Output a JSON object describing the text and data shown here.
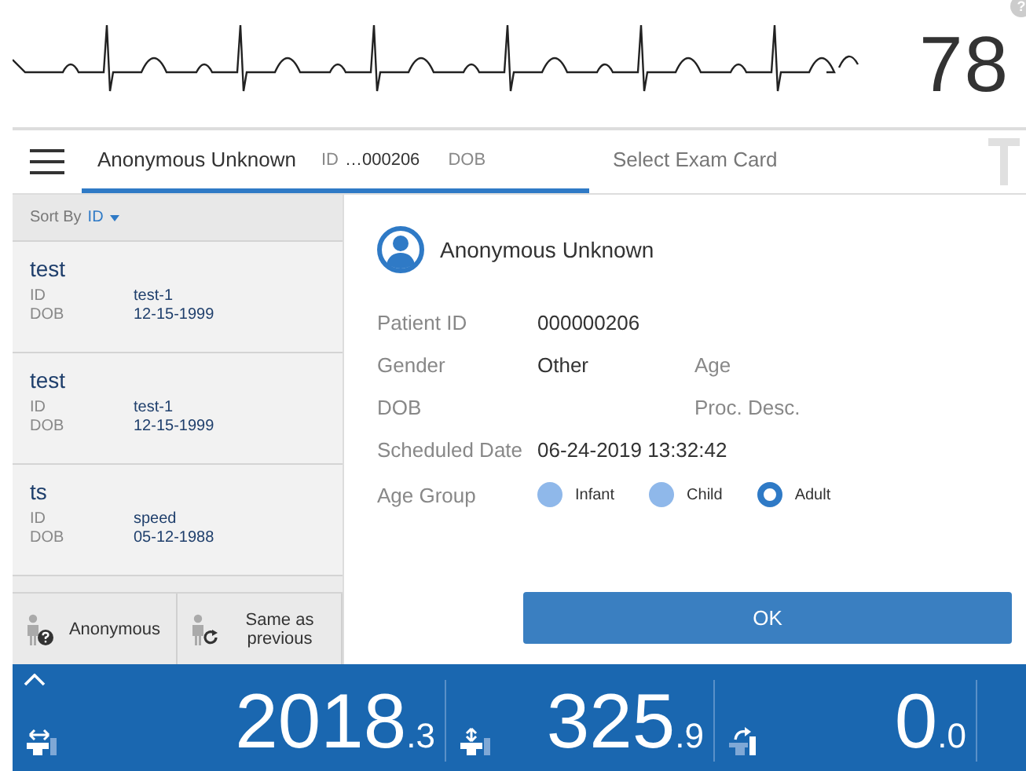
{
  "monitor": {
    "heart_rate": "78",
    "help": "?"
  },
  "tabs": [
    {
      "kind": "patient",
      "name": "Anonymous Unknown",
      "id_label": "ID",
      "id_value": "…000206",
      "dob_label": "DOB",
      "selected": true
    },
    {
      "kind": "exam",
      "label": "Select Exam Card",
      "selected": false
    }
  ],
  "sort": {
    "label": "Sort By",
    "value": "ID"
  },
  "patients": [
    {
      "name": "test",
      "id_label": "ID",
      "id": "test-1",
      "dob_label": "DOB",
      "dob": "12-15-1999"
    },
    {
      "name": "test",
      "id_label": "ID",
      "id": "test-1",
      "dob_label": "DOB",
      "dob": "12-15-1999"
    },
    {
      "name": "ts",
      "id_label": "ID",
      "id": "speed",
      "dob_label": "DOB",
      "dob": "05-12-1988"
    }
  ],
  "quick_buttons": [
    {
      "kind": "anonymous",
      "label": "Anonymous"
    },
    {
      "kind": "same",
      "label": "Same as previous"
    }
  ],
  "details": {
    "name": "Anonymous Unknown",
    "rows": [
      [
        {
          "label": "Patient ID",
          "value": "000000206"
        }
      ],
      [
        {
          "label": "Gender",
          "value": "Other"
        },
        {
          "label": "Age"
        }
      ],
      [
        {
          "label": "DOB"
        },
        {
          "label": "Proc. Desc."
        }
      ],
      [
        {
          "label": "Scheduled Date",
          "value": "06-24-2019 13:32:42"
        }
      ]
    ],
    "age_group": {
      "label": "Age Group",
      "options": [
        {
          "label": "Infant",
          "selected": false
        },
        {
          "label": "Child",
          "selected": false
        },
        {
          "label": "Adult",
          "selected": true
        }
      ]
    },
    "ok": "OK"
  },
  "readouts": [
    {
      "kind": "horizontal",
      "whole": "2018",
      "decimal": ".3"
    },
    {
      "kind": "vertical",
      "whole": "325",
      "decimal": ".9"
    },
    {
      "kind": "rotate",
      "whole": "0",
      "decimal": ".0"
    }
  ]
}
